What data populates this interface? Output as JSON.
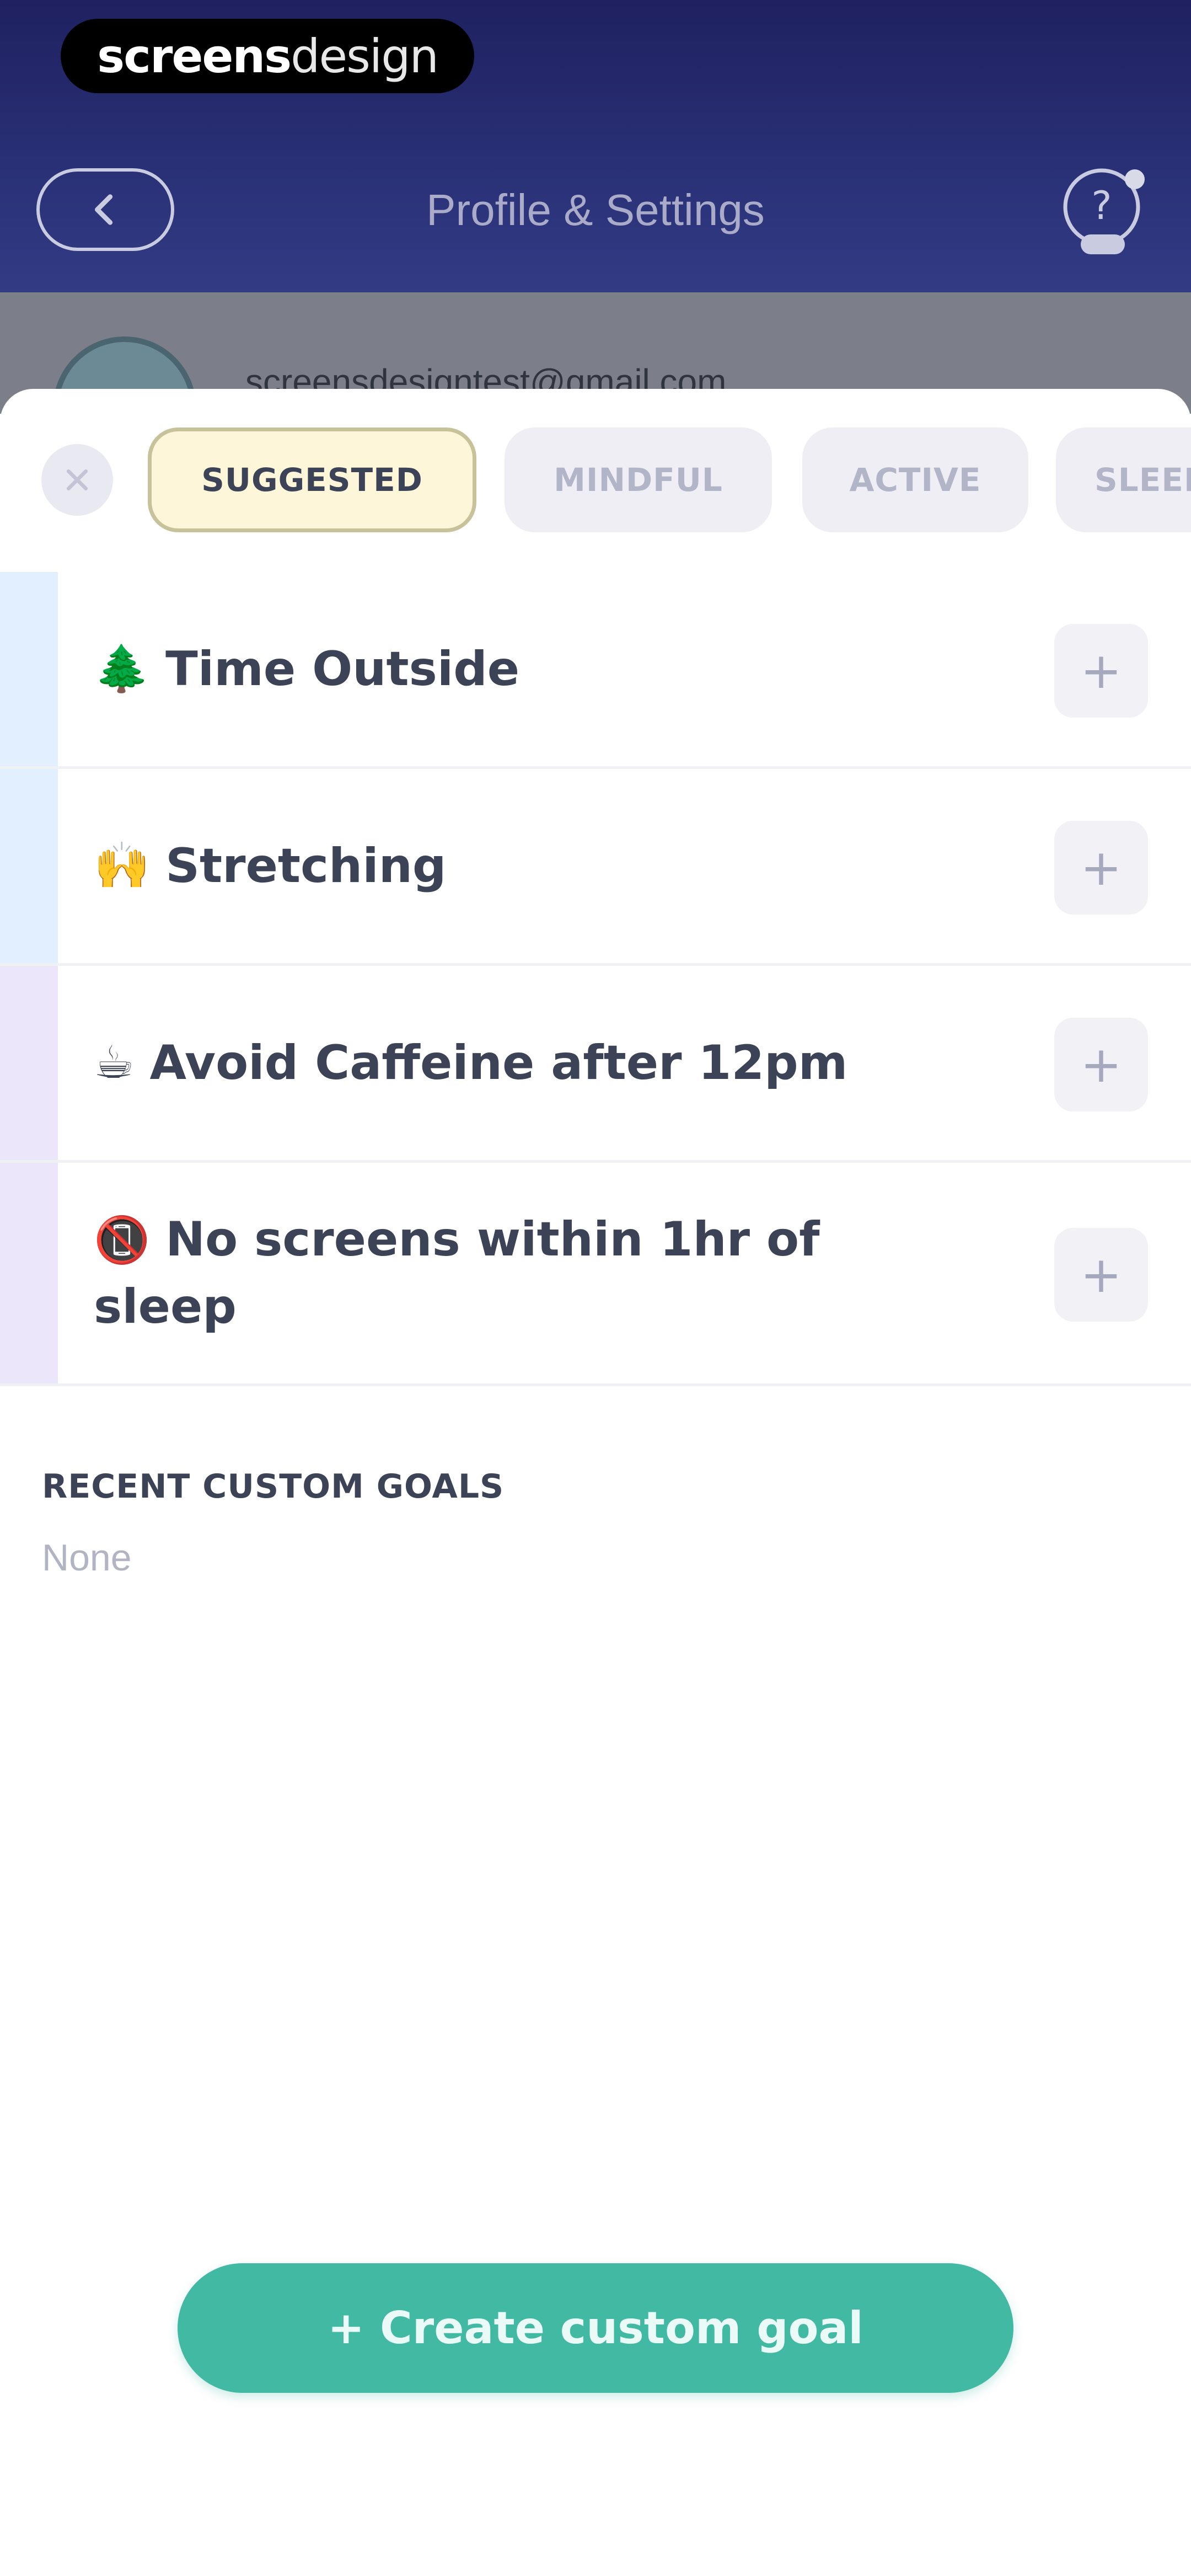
{
  "brand": {
    "part1": "screens",
    "part2": "design"
  },
  "nav": {
    "title": "Profile & Settings",
    "back_icon": "chevron-left-icon",
    "help_icon": "help-chat-icon"
  },
  "profile": {
    "email": "screensdesigntest@gmail.com"
  },
  "sheet": {
    "close_icon": "close-icon",
    "tabs": [
      {
        "label": "SUGGESTED",
        "active": true
      },
      {
        "label": "MINDFUL",
        "active": false
      },
      {
        "label": "ACTIVE",
        "active": false
      },
      {
        "label": "SLEEP",
        "active": false
      }
    ],
    "goals": [
      {
        "emoji": "🌲",
        "label": "Time Outside",
        "accent": "#e2efff",
        "add": "+"
      },
      {
        "emoji": "🙌",
        "label": "Stretching",
        "accent": "#e2efff",
        "add": "+"
      },
      {
        "emoji": "☕",
        "label": "Avoid Caffeine after 12pm",
        "accent": "#ece6fb",
        "add": "+"
      },
      {
        "emoji": "📵",
        "label": "No screens within 1hr of sleep",
        "accent": "#ece6fb",
        "add": "+"
      }
    ],
    "recent_title": "RECENT CUSTOM GOALS",
    "recent_empty": "None",
    "create_button": "+ Create custom goal"
  },
  "colors": {
    "header": "#2a3177",
    "primary_button": "#41b9a3",
    "active_chip_bg": "#fdf6d8",
    "text_dark": "#3d4356"
  }
}
